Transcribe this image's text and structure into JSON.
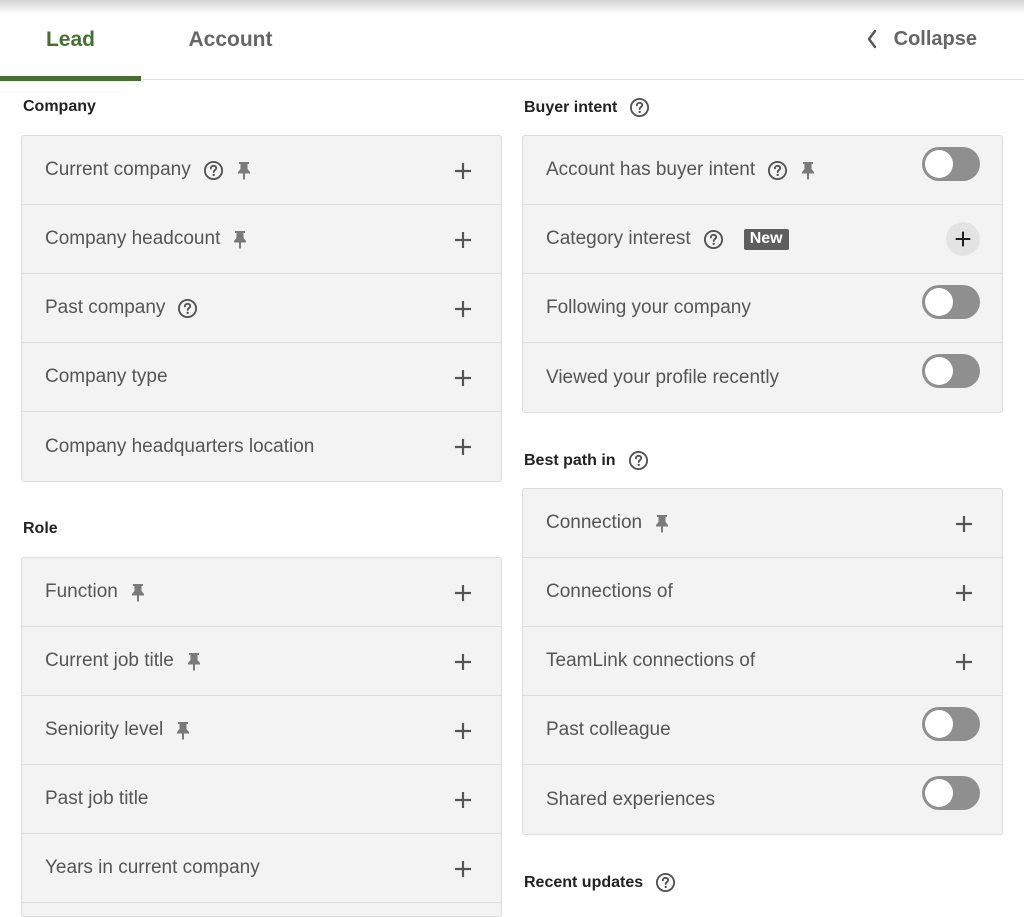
{
  "tabs": [
    {
      "label": "Lead",
      "active": true
    },
    {
      "label": "Account",
      "active": false
    }
  ],
  "collapse": {
    "label": "Collapse",
    "icon": "chevron-left-icon"
  },
  "left": {
    "company": {
      "title": "Company",
      "rows": [
        {
          "label": "Current company",
          "help": true,
          "pinned": true,
          "control": "add"
        },
        {
          "label": "Company headcount",
          "help": false,
          "pinned": true,
          "control": "add"
        },
        {
          "label": "Past company",
          "help": true,
          "pinned": false,
          "control": "add"
        },
        {
          "label": "Company type",
          "help": false,
          "pinned": false,
          "control": "add"
        },
        {
          "label": "Company headquarters location",
          "help": false,
          "pinned": false,
          "control": "add"
        }
      ]
    },
    "role": {
      "title": "Role",
      "rows": [
        {
          "label": "Function",
          "pinned": true,
          "control": "add"
        },
        {
          "label": "Current job title",
          "pinned": true,
          "control": "add"
        },
        {
          "label": "Seniority level",
          "pinned": true,
          "control": "add"
        },
        {
          "label": "Past job title",
          "pinned": false,
          "control": "add"
        },
        {
          "label": "Years in current company",
          "pinned": false,
          "control": "add"
        }
      ]
    }
  },
  "right": {
    "buyer_intent": {
      "title": "Buyer intent",
      "rows": [
        {
          "label": "Account has buyer intent",
          "help": true,
          "pinned": true,
          "control": "toggle",
          "on": false
        },
        {
          "label": "Category interest",
          "help": true,
          "badge": "New",
          "control": "add-circle"
        },
        {
          "label": "Following your company",
          "control": "toggle",
          "on": false
        },
        {
          "label": "Viewed your profile recently",
          "control": "toggle",
          "on": false
        }
      ]
    },
    "best_path": {
      "title": "Best path in",
      "rows": [
        {
          "label": "Connection",
          "pinned": true,
          "control": "add"
        },
        {
          "label": "Connections of",
          "control": "add"
        },
        {
          "label": "TeamLink connections of",
          "control": "add"
        },
        {
          "label": "Past colleague",
          "control": "toggle",
          "on": false
        },
        {
          "label": "Shared experiences",
          "control": "toggle",
          "on": false
        }
      ]
    },
    "recent_updates": {
      "title": "Recent updates"
    }
  },
  "colors": {
    "accent": "#44712e",
    "toggle_off": "#8f8f8f",
    "badge_bg": "#5e5e5e",
    "row_bg": "#f3f3f4"
  }
}
